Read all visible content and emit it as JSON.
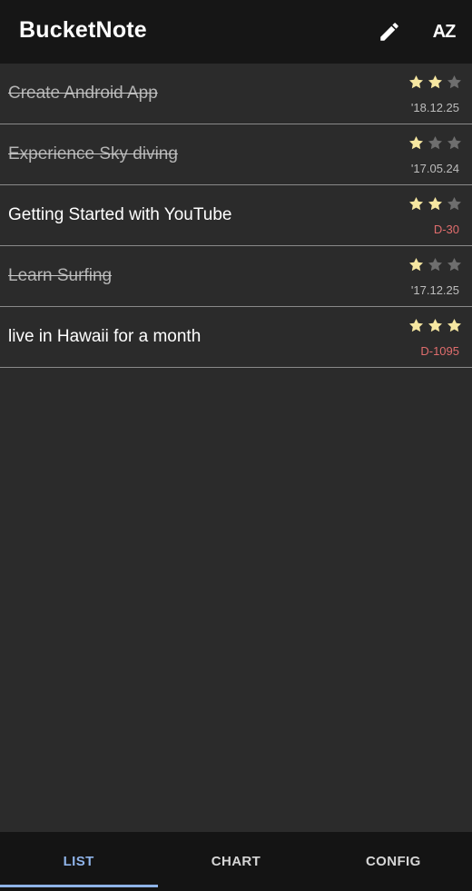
{
  "app": {
    "title": "BucketNote"
  },
  "toolbar": {
    "edit_icon": "pencil-icon",
    "sort_icon": "sort-az-icon",
    "sort_glyph": "AZ"
  },
  "colors": {
    "star_on": "#f6e7a1",
    "star_off": "#6e6e6e",
    "due": "#e06d6d",
    "accent": "#8fb3e8"
  },
  "items": [
    {
      "title": "Create Android App",
      "rating": 2,
      "date": "'18.12.25",
      "done": true
    },
    {
      "title": "Experience Sky diving",
      "rating": 1,
      "date": "'17.05.24",
      "done": true
    },
    {
      "title": "Getting Started with YouTube",
      "rating": 2,
      "date": "D-30",
      "done": false
    },
    {
      "title": "Learn Surfing",
      "rating": 1,
      "date": "'17.12.25",
      "done": true
    },
    {
      "title": "live in Hawaii for a month",
      "rating": 3,
      "date": "D-1095",
      "done": false
    }
  ],
  "tabs": [
    {
      "label": "LIST",
      "active": true
    },
    {
      "label": "CHART",
      "active": false
    },
    {
      "label": "CONFIG",
      "active": false
    }
  ]
}
